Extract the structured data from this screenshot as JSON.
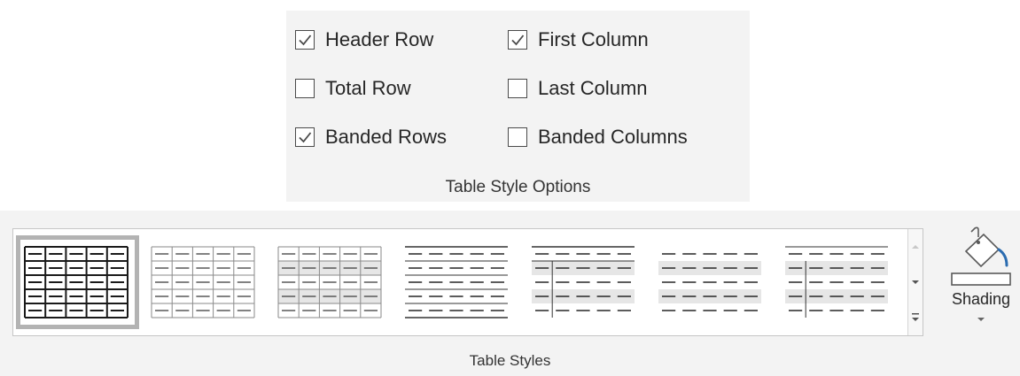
{
  "table_style_options": {
    "title": "Table Style Options",
    "options": [
      {
        "label": "Header Row",
        "checked": true
      },
      {
        "label": "First Column",
        "checked": true
      },
      {
        "label": "Total Row",
        "checked": false
      },
      {
        "label": "Last Column",
        "checked": false
      },
      {
        "label": "Banded Rows",
        "checked": true
      },
      {
        "label": "Banded Columns",
        "checked": false
      }
    ]
  },
  "table_styles": {
    "title": "Table Styles",
    "gallery": [
      {
        "style": "table-grid",
        "selected": true
      },
      {
        "style": "plain-grid-light",
        "selected": false
      },
      {
        "style": "grid-banded-shaded",
        "selected": false
      },
      {
        "style": "horizontal-lines",
        "selected": false
      },
      {
        "style": "banded-first-column-lines",
        "selected": false
      },
      {
        "style": "banded-rows-plain",
        "selected": false
      },
      {
        "style": "banded-first-column-plain",
        "selected": false
      }
    ],
    "scroll_icons": [
      "scroll-up-icon",
      "scroll-down-icon",
      "more-styles-icon"
    ],
    "shading": {
      "label": "Shading",
      "icon": "paint-bucket-icon",
      "accent": "#2b6cb0"
    }
  },
  "colors": {
    "panel_bg": "#f3f3f3",
    "check": "#4a4a4a",
    "selection_border": "#b3b3b3",
    "band_fill": "#e6e6e6"
  }
}
